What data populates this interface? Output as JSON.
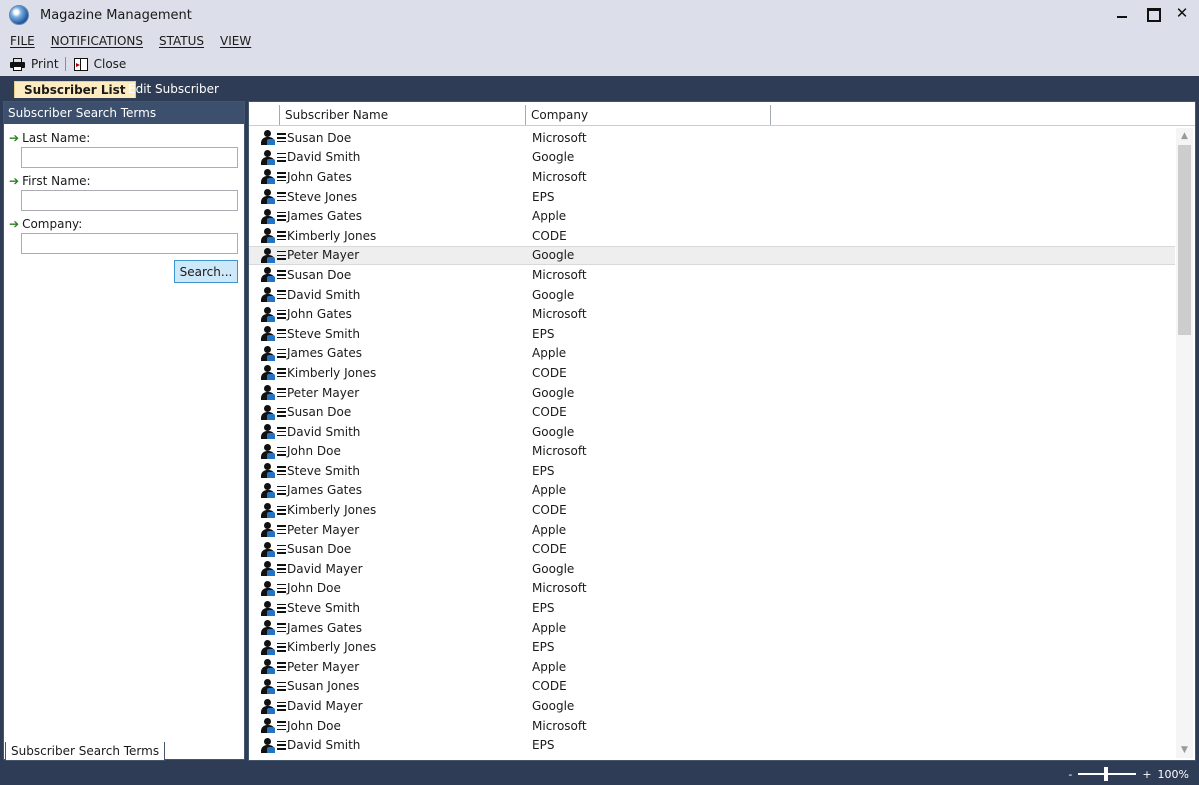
{
  "window": {
    "title": "Magazine Management"
  },
  "menu": [
    {
      "label": "FILE"
    },
    {
      "label": "NOTIFICATIONS"
    },
    {
      "label": "STATUS"
    },
    {
      "label": "VIEW"
    }
  ],
  "toolbar": {
    "print_label": "Print",
    "close_label": "Close"
  },
  "tabs": [
    {
      "label": "Subscriber List",
      "active": true
    },
    {
      "label": "Edit Subscriber",
      "active": false
    }
  ],
  "search_panel": {
    "header": "Subscriber Search Terms",
    "last_name_label": "Last Name:",
    "last_name_value": "",
    "first_name_label": "First Name:",
    "first_name_value": "",
    "company_label": "Company:",
    "company_value": "",
    "search_button": "Search...",
    "bottom_tab": "Subscriber Search Terms"
  },
  "grid": {
    "columns": [
      "Subscriber Name",
      "Company"
    ],
    "selected_row_index": 6,
    "rows": [
      {
        "name": "Susan Doe",
        "company": "Microsoft"
      },
      {
        "name": "David Smith",
        "company": "Google"
      },
      {
        "name": "John Gates",
        "company": "Microsoft"
      },
      {
        "name": "Steve Jones",
        "company": "EPS"
      },
      {
        "name": "James Gates",
        "company": "Apple"
      },
      {
        "name": "Kimberly Jones",
        "company": "CODE"
      },
      {
        "name": "Peter Mayer",
        "company": "Google"
      },
      {
        "name": "Susan Doe",
        "company": "Microsoft"
      },
      {
        "name": "David Smith",
        "company": "Google"
      },
      {
        "name": "John Gates",
        "company": "Microsoft"
      },
      {
        "name": "Steve Smith",
        "company": "EPS"
      },
      {
        "name": "James Gates",
        "company": "Apple"
      },
      {
        "name": "Kimberly Jones",
        "company": "CODE"
      },
      {
        "name": "Peter Mayer",
        "company": "Google"
      },
      {
        "name": "Susan Doe",
        "company": "CODE"
      },
      {
        "name": "David Smith",
        "company": "Google"
      },
      {
        "name": "John Doe",
        "company": "Microsoft"
      },
      {
        "name": "Steve Smith",
        "company": "EPS"
      },
      {
        "name": "James Gates",
        "company": "Apple"
      },
      {
        "name": "Kimberly Jones",
        "company": "CODE"
      },
      {
        "name": "Peter Mayer",
        "company": "Apple"
      },
      {
        "name": "Susan Doe",
        "company": "CODE"
      },
      {
        "name": "David Mayer",
        "company": "Google"
      },
      {
        "name": "John Doe",
        "company": "Microsoft"
      },
      {
        "name": "Steve Smith",
        "company": "EPS"
      },
      {
        "name": "James Gates",
        "company": "Apple"
      },
      {
        "name": "Kimberly Jones",
        "company": "EPS"
      },
      {
        "name": "Peter Mayer",
        "company": "Apple"
      },
      {
        "name": "Susan Jones",
        "company": "CODE"
      },
      {
        "name": "David Mayer",
        "company": "Google"
      },
      {
        "name": "John Doe",
        "company": "Microsoft"
      },
      {
        "name": "David Smith",
        "company": "EPS"
      }
    ]
  },
  "statusbar": {
    "zoom_minus": "-",
    "zoom_plus": "+",
    "zoom_level": "100%"
  },
  "icons": {
    "app": "globe-icon",
    "print": "printer-icon",
    "close": "exit-icon",
    "row": "person-card-icon",
    "field_arrow": "green-arrow-icon"
  },
  "colors": {
    "chrome": "#dcdfe9",
    "frame": "#2e3d55",
    "panel_header": "#3c4f6d",
    "active_tab": "#fdecc0",
    "search_button": "#cde8f8",
    "badge": "#2773c3"
  }
}
